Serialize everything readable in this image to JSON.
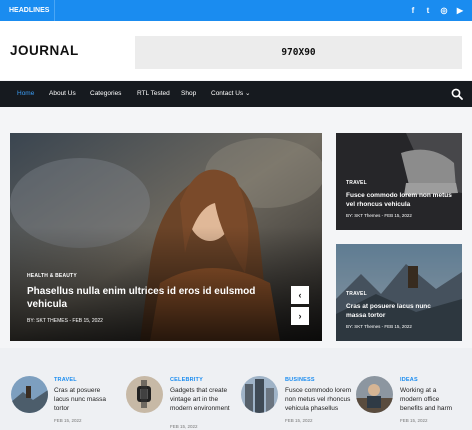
{
  "topbar": {
    "headlines_label": "HEADLINES",
    "social": [
      {
        "icon": "facebook-icon",
        "glyph": "f"
      },
      {
        "icon": "twitter-icon",
        "glyph": "t"
      },
      {
        "icon": "instagram-icon",
        "glyph": "◎"
      },
      {
        "icon": "youtube-icon",
        "glyph": "▶"
      }
    ]
  },
  "header": {
    "logo": "JOURNAL",
    "ad_text": "970X90"
  },
  "nav": {
    "items": [
      {
        "label": "Home",
        "active": true
      },
      {
        "label": "About Us"
      },
      {
        "label": "Categories"
      },
      {
        "label": "RTL Tested"
      },
      {
        "label": "Shop"
      },
      {
        "label": "Contact Us ⌄"
      }
    ],
    "search_icon": "search-icon"
  },
  "hero": {
    "tag": "HEALTH & BEAUTY",
    "title": "Phasellus nulla enim ultrices id eros id eulsmod vehicula",
    "meta": "BY: SKT THEMES  -  FEB 15, 2022",
    "prev_icon": "‹",
    "next_icon": "›"
  },
  "side_cards": [
    {
      "tag": "TRAVEL",
      "title": "Fusce commodo lorem non metus vel rhoncus vehicula",
      "meta": "BY: SKT Themes  -  FEB 15, 2022"
    },
    {
      "tag": "TRAVEL",
      "title": "Cras at posuere lacus nunc massa tortor",
      "meta": "BY: SKT Themes  -  FEB 15, 2022"
    }
  ],
  "posts": [
    {
      "category": "TRAVEL",
      "title": "Cras at posuere lacus nunc massa tortor",
      "date": "FEB 15, 2022"
    },
    {
      "category": "CELEBRITY",
      "title": "Gadgets that create vintage art in the modern environment",
      "date": "FEB 15, 2022"
    },
    {
      "category": "BUSINESS",
      "title": "Fusce commodo lorem non metus vel rhoncus vehicula phasellus",
      "date": "FEB 15, 2022"
    },
    {
      "category": "IDEAS",
      "title": "Working at a modern office benefits and harm",
      "date": "FEB 15, 2022"
    }
  ],
  "colors": {
    "accent": "#1a8cf0",
    "nav_bg": "#161a1f"
  }
}
